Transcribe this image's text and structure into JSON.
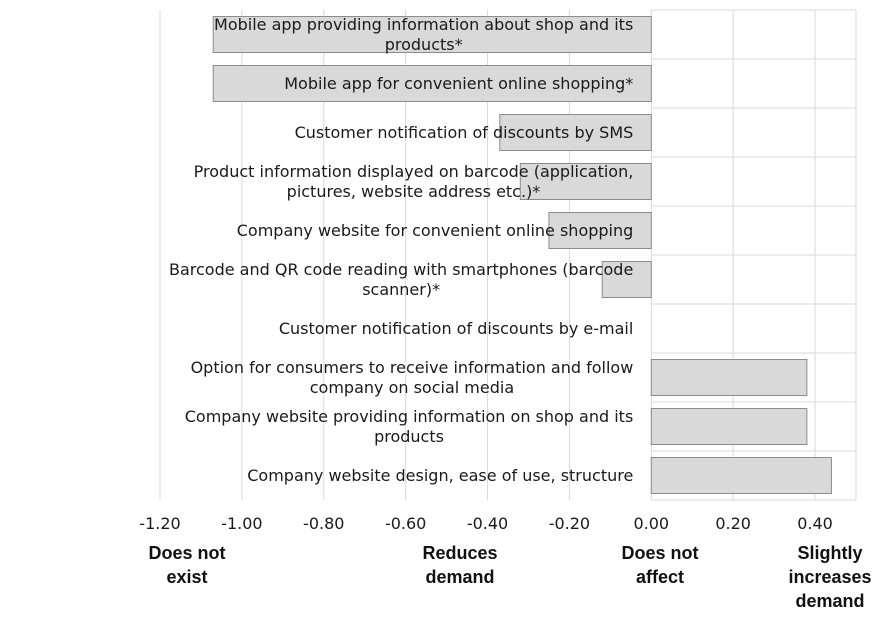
{
  "chart_data": {
    "type": "bar",
    "orientation": "horizontal",
    "categories": [
      "Mobile app providing information about shop and its\nproducts*",
      "Mobile app for convenient online shopping*",
      "Customer notification of discounts by SMS",
      "Product information displayed on barcode (application,\npictures, website address etc.)*",
      "Company website for convenient online shopping",
      "Barcode and QR code reading with smartphones (barcode\nscanner)*",
      "Customer notification of discounts by e-mail",
      "Option for consumers to receive information and follow\ncompany on social media",
      "Company website providing information on shop and its\nproducts",
      "Company website design, ease of use, structure"
    ],
    "values": [
      -1.07,
      -1.07,
      -0.37,
      -0.32,
      -0.25,
      -0.12,
      0.0,
      0.38,
      0.38,
      0.44
    ],
    "xlim": [
      -1.2,
      0.5
    ],
    "x_ticks": [
      "-1.20",
      "-1.00",
      "-0.80",
      "-0.60",
      "-0.40",
      "-0.20",
      "0.00",
      "0.20",
      "0.40"
    ],
    "axis_notes": [
      "Does not\nexist",
      "Reduces\ndemand",
      "Does not\naffect",
      "Slightly\nincreases\ndemand"
    ],
    "grid": true,
    "bar_color": "#d9d9d9",
    "bar_edge_color": "#8c8c8c",
    "grid_color": "#d9d9d9"
  }
}
